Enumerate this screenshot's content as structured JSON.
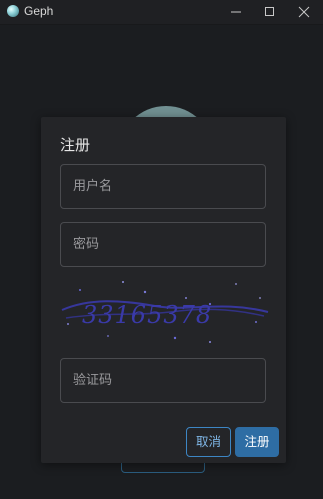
{
  "window": {
    "title": "Geph",
    "app_icon": "geph-logo-icon",
    "controls": [
      "minimize-icon",
      "maximize-icon",
      "close-icon"
    ]
  },
  "dialog": {
    "title": "注册",
    "username_placeholder": "用户名",
    "password_placeholder": "密码",
    "captcha_text": "33165378",
    "captcha_placeholder": "验证码",
    "cancel_label": "取消",
    "register_label": "注册"
  },
  "colors": {
    "accent": "#2e6da4",
    "captcha_ink": "#3a3aa8"
  }
}
